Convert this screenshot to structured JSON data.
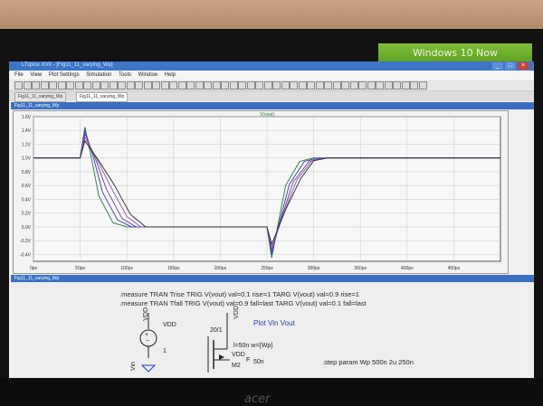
{
  "sticker": "Windows 10 Now",
  "window_title": "LTspice XVII - [Fig11_11_varying_Wp]",
  "menu": [
    "File",
    "View",
    "Plot Settings",
    "Simulation",
    "Tools",
    "Window",
    "Help"
  ],
  "tabs": [
    "Fig11_11_varying_Wp",
    "Fig11_11_varying_Wp"
  ],
  "plot_window_title": "Fig11_11_varying_Wp",
  "schem_window_title": "Fig11_11_varying_Wp",
  "chart_data": {
    "type": "line",
    "title": "V(vout)",
    "ylim": [
      -0.5,
      1.6
    ],
    "xlim": [
      0,
      500
    ],
    "x_ticks": [
      "0ps",
      "50ps",
      "100ps",
      "150ps",
      "200ps",
      "250ps",
      "300ps",
      "350ps",
      "400ps",
      "450ps"
    ],
    "y_ticks": [
      "1.6V",
      "1.4V",
      "1.2V",
      "1.0V",
      "0.8V",
      "0.6V",
      "0.4V",
      "0.2V",
      "0.0V",
      "-0.2V",
      "-0.4V"
    ],
    "grid": true,
    "series": [
      {
        "x": [
          0,
          50,
          55,
          62,
          70,
          85,
          100,
          150,
          200,
          240,
          250,
          255,
          262,
          270,
          285,
          300,
          500
        ],
        "y": [
          1.0,
          1.0,
          1.45,
          1.0,
          0.45,
          0.06,
          0.0,
          0.0,
          0.0,
          0.0,
          0.0,
          -0.45,
          0.05,
          0.6,
          0.95,
          1.0,
          1.0
        ]
      },
      {
        "x": [
          0,
          50,
          55,
          64,
          74,
          90,
          105,
          150,
          200,
          240,
          250,
          255,
          264,
          274,
          290,
          305,
          500
        ],
        "y": [
          1.0,
          1.0,
          1.4,
          1.02,
          0.5,
          0.1,
          0.0,
          0.0,
          0.0,
          0.0,
          0.0,
          -0.4,
          0.1,
          0.62,
          0.95,
          1.0,
          1.0
        ]
      },
      {
        "x": [
          0,
          50,
          55,
          66,
          78,
          95,
          110,
          150,
          200,
          240,
          250,
          255,
          266,
          278,
          295,
          310,
          500
        ],
        "y": [
          1.0,
          1.0,
          1.35,
          1.0,
          0.55,
          0.12,
          0.0,
          0.0,
          0.0,
          0.0,
          0.0,
          -0.35,
          0.15,
          0.65,
          0.95,
          1.0,
          1.0
        ]
      },
      {
        "x": [
          0,
          50,
          55,
          68,
          82,
          100,
          115,
          150,
          200,
          240,
          250,
          255,
          268,
          282,
          298,
          312,
          500
        ],
        "y": [
          1.0,
          1.0,
          1.3,
          0.98,
          0.6,
          0.15,
          0.0,
          0.0,
          0.0,
          0.0,
          0.0,
          -0.3,
          0.2,
          0.68,
          0.96,
          1.0,
          1.0
        ]
      },
      {
        "x": [
          0,
          50,
          55,
          70,
          86,
          104,
          120,
          150,
          200,
          240,
          250,
          255,
          270,
          286,
          300,
          315,
          500
        ],
        "y": [
          1.0,
          1.0,
          1.25,
          0.96,
          0.62,
          0.18,
          0.0,
          0.0,
          0.0,
          0.0,
          0.0,
          -0.25,
          0.25,
          0.7,
          0.96,
          1.0,
          1.0
        ]
      }
    ],
    "series_colors": [
      "#1f7a3a",
      "#3a3aa8",
      "#6a3aa0",
      "#8a5aa8",
      "#2a2a2a"
    ]
  },
  "measure_lines": [
    ".measure TRAN Trise TRIG V(vout) val=0.1 rise=1 TARG V(vout) val=0.9 rise=1",
    ".measure TRAN Tfall TRIG V(vout) val=0.9 fall=last TARG V(vout) val=0.1 fall=last"
  ],
  "schematic": {
    "vdd_label": "VDD",
    "vdd_label2": "VDD",
    "vdd_source_value": "1",
    "vin_label": "Vin",
    "ratio": "20/1",
    "plot_label": "Plot Vin Vout",
    "mos_params": "l=50n w={Wp}",
    "vdd_pin": "VDD",
    "m_label": "M2",
    "f_label": "F",
    "f_value": "50n",
    "step_line": ".step param Wp 500n 2u 250n"
  },
  "laptop_logo": "acer"
}
